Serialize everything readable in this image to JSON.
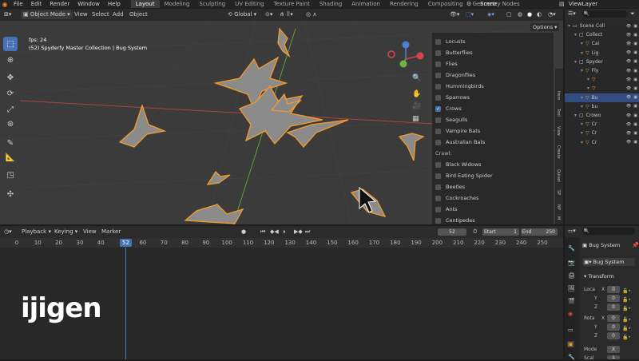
{
  "topbar": {
    "menus": [
      "File",
      "Edit",
      "Render",
      "Window",
      "Help"
    ],
    "workspaces": [
      "Layout",
      "Modeling",
      "Sculpting",
      "UV Editing",
      "Texture Paint",
      "Shading",
      "Animation",
      "Rendering",
      "Compositing",
      "Geometry Nodes"
    ],
    "active_workspace": "Layout",
    "scene": "Scene",
    "view_layer": "ViewLayer"
  },
  "viewport_header": {
    "mode": "Object Mode",
    "menus": [
      "View",
      "Select",
      "Add",
      "Object"
    ],
    "orientation": "Global",
    "options": "Options"
  },
  "viewport": {
    "fps": "fps: 24",
    "info": "(52) Spyderfy Master Collection | Bug System"
  },
  "bug_list": {
    "items": [
      {
        "label": "Locusts",
        "checked": false
      },
      {
        "label": "Butterflies",
        "checked": false
      },
      {
        "label": "Flies",
        "checked": false
      },
      {
        "label": "Dragonflies",
        "checked": false
      },
      {
        "label": "Hummingbirds",
        "checked": false
      },
      {
        "label": "Sparrows",
        "checked": false
      },
      {
        "label": "Crows",
        "checked": true
      },
      {
        "label": "Seagulls",
        "checked": false
      },
      {
        "label": "Vampire Bats",
        "checked": false
      },
      {
        "label": "Australian Bats",
        "checked": false
      }
    ],
    "crawl_label": "Crawl:",
    "crawl_items": [
      {
        "label": "Black Widows",
        "checked": false
      },
      {
        "label": "Bird Eating Spider",
        "checked": false
      },
      {
        "label": "Beetles",
        "checked": false
      },
      {
        "label": "Cockroaches",
        "checked": false
      },
      {
        "label": "Ants",
        "checked": false
      },
      {
        "label": "Centipedes",
        "checked": false
      }
    ]
  },
  "side_tabs": [
    "Item",
    "Tool",
    "View",
    "Create",
    "Quixel",
    "SP",
    "NP",
    "M"
  ],
  "outliner": {
    "rows": [
      {
        "label": "Scene Coll",
        "indent": 0
      },
      {
        "label": "Collect",
        "indent": 1
      },
      {
        "label": "Cai",
        "indent": 2
      },
      {
        "label": "Lig",
        "indent": 2
      },
      {
        "label": "Spyder",
        "indent": 1
      },
      {
        "label": "Fly",
        "indent": 2
      },
      {
        "label": "",
        "indent": 3
      },
      {
        "label": "",
        "indent": 3
      },
      {
        "label": "Bu",
        "indent": 2,
        "selected": true
      },
      {
        "label": "bu",
        "indent": 2
      },
      {
        "label": "Crowo",
        "indent": 1
      },
      {
        "label": "Cr",
        "indent": 2
      },
      {
        "label": "Cr",
        "indent": 2
      },
      {
        "label": "Cr",
        "indent": 2
      }
    ]
  },
  "timeline": {
    "menus": [
      "Playback",
      "Keying",
      "View",
      "Marker"
    ],
    "current_frame": "52",
    "start_label": "Start",
    "start": "1",
    "end_label": "End",
    "end": "250",
    "ticks": [
      "0",
      "10",
      "20",
      "30",
      "40",
      "52",
      "60",
      "70",
      "80",
      "90",
      "100",
      "110",
      "120",
      "130",
      "140",
      "150",
      "160",
      "170",
      "180",
      "190",
      "200",
      "210",
      "220",
      "230",
      "240",
      "250"
    ],
    "logo": "ijigen"
  },
  "properties": {
    "object_name": "Bug System",
    "data_name": "Bug System",
    "transform_label": "Transform",
    "location_label": "Loca",
    "rotation_label": "Rota",
    "scale_label": "Scal",
    "x_label": "X",
    "y_label": "Y",
    "z_label": "Z",
    "loc": [
      "0",
      "0",
      "0"
    ],
    "rot": [
      "0",
      "0",
      "0"
    ],
    "mode_label": "Mode",
    "mode_value": "X",
    "scale_value": "1"
  },
  "colors": {
    "accent": "#4772b3",
    "selection_outline": "#f59b2a",
    "viewport_bg": "#3b3b3b"
  }
}
